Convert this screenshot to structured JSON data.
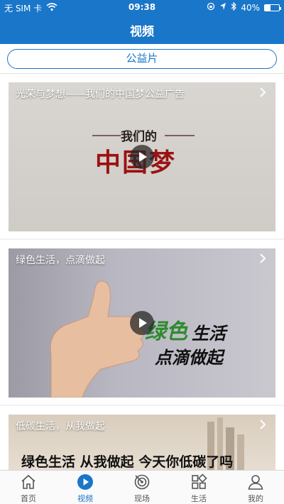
{
  "status_bar": {
    "carrier": "无 SIM 卡",
    "time": "09:38",
    "battery_percent": "40%",
    "battery_level": 0.4,
    "icons": [
      "wifi-icon",
      "lock-rotation-icon",
      "location-icon",
      "bluetooth-icon",
      "battery-icon"
    ]
  },
  "nav": {
    "title": "视频"
  },
  "category": {
    "label": "公益片"
  },
  "cards": [
    {
      "caption": "光荣与梦想——我们的中国梦公益广告",
      "overlay_small": "我们的",
      "overlay_big": "中国梦"
    },
    {
      "caption": "绿色生活，点滴做起",
      "overlay_green": "绿色",
      "overlay_black1": "生活",
      "overlay_black2": "点滴做起"
    },
    {
      "caption": "低碳生活，从我做起",
      "overlay_banner": "绿色生活 从我做起 今天你低碳了吗"
    }
  ],
  "tabs": [
    {
      "label": "首页",
      "icon": "home-icon",
      "active": false
    },
    {
      "label": "视频",
      "icon": "play-circle-icon",
      "active": true
    },
    {
      "label": "现场",
      "icon": "target-icon",
      "active": false
    },
    {
      "label": "生活",
      "icon": "grid-icon",
      "active": false
    },
    {
      "label": "我的",
      "icon": "person-icon",
      "active": false
    }
  ],
  "colors": {
    "primary": "#1a76c9",
    "tab_inactive": "#555555",
    "china_dream_red": "#9b1212",
    "green_text": "#2e8b2e"
  }
}
